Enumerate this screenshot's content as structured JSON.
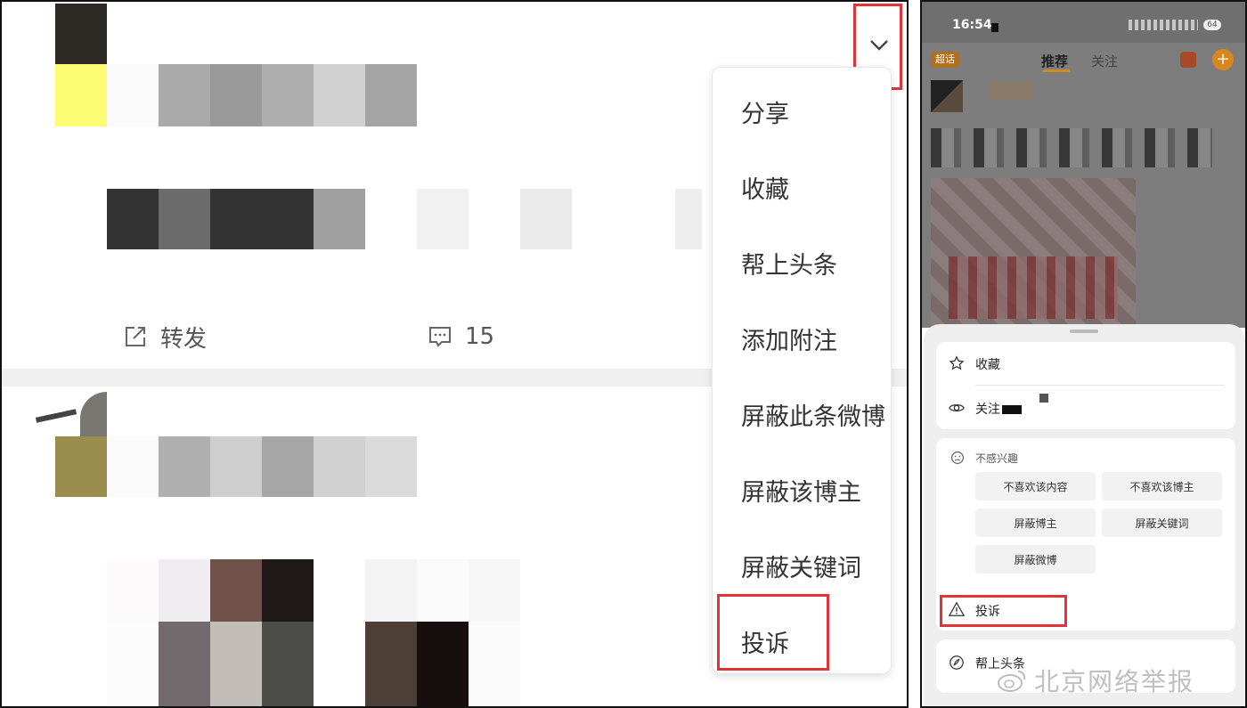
{
  "left_panel": {
    "dropdown_toggle": "chevron-down-icon",
    "post_actions": {
      "repost_label": "转发",
      "comment_count": "15"
    },
    "menu_items": [
      "分享",
      "收藏",
      "帮上头条",
      "添加附注",
      "屏蔽此条微博",
      "屏蔽该博主",
      "屏蔽关键词",
      "投诉"
    ],
    "highlight_color": "#e0343a"
  },
  "right_panel": {
    "status_bar": {
      "time": "16:54",
      "battery": "64"
    },
    "top_nav": {
      "super_topic_badge": "超话",
      "tab_recommend": "推荐",
      "tab_follow": "关注"
    },
    "sheet": {
      "favorite_label": "收藏",
      "follow_label": "关注",
      "not_interested_title": "不感兴趣",
      "chips": [
        "不喜欢该内容",
        "不喜欢该博主",
        "屏蔽博主",
        "屏蔽关键词",
        "屏蔽微博"
      ],
      "report_label": "投诉",
      "boost_label": "帮上头条"
    },
    "watermark": "北京网络举报"
  }
}
